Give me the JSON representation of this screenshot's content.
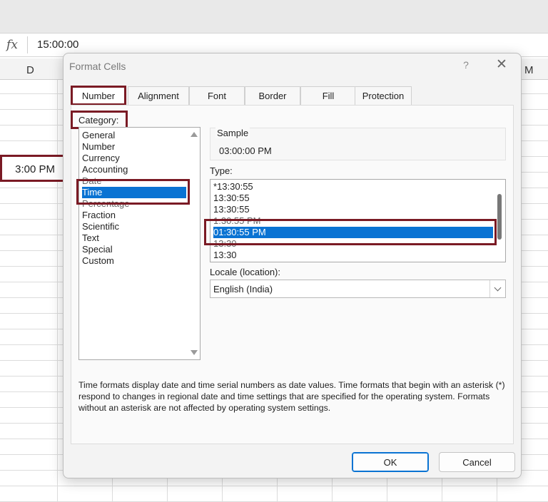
{
  "formula_bar": {
    "fx_label": "fx",
    "value": "15:00:00"
  },
  "sheet": {
    "column_left": "D",
    "column_right": "M",
    "active_cell_text": "3:00 PM"
  },
  "dialog": {
    "title": "Format Cells",
    "help_icon": "?",
    "close_icon": "✕",
    "tabs": [
      {
        "label": "Number",
        "active": true
      },
      {
        "label": "Alignment",
        "active": false
      },
      {
        "label": "Font",
        "active": false
      },
      {
        "label": "Border",
        "active": false
      },
      {
        "label": "Fill",
        "active": false
      },
      {
        "label": "Protection",
        "active": false
      }
    ],
    "category_label": "Category:",
    "categories": [
      "General",
      "Number",
      "Currency",
      "Accounting",
      "Date",
      "Time",
      "Percentage",
      "Fraction",
      "Scientific",
      "Text",
      "Special",
      "Custom"
    ],
    "selected_category": "Time",
    "sample": {
      "title": "Sample",
      "value": "03:00:00 PM"
    },
    "type_label": "Type:",
    "types": [
      "*13:30:55",
      "13:30:55",
      "13:30:55",
      "1:30:55 PM",
      "01:30:55 PM",
      "13:30",
      "13:30"
    ],
    "selected_type": "01:30:55 PM",
    "locale_label": "Locale (location):",
    "locale_value": "English (India)",
    "description": "Time formats display date and time serial numbers as date values.  Time formats that begin with an asterisk (*) respond to changes in regional date and time settings that are specified for the operating system. Formats without an asterisk are not affected by operating system settings.",
    "ok_label": "OK",
    "cancel_label": "Cancel"
  },
  "colors": {
    "selection_blue": "#0a73d3",
    "highlight_box": "#7a1a24"
  }
}
